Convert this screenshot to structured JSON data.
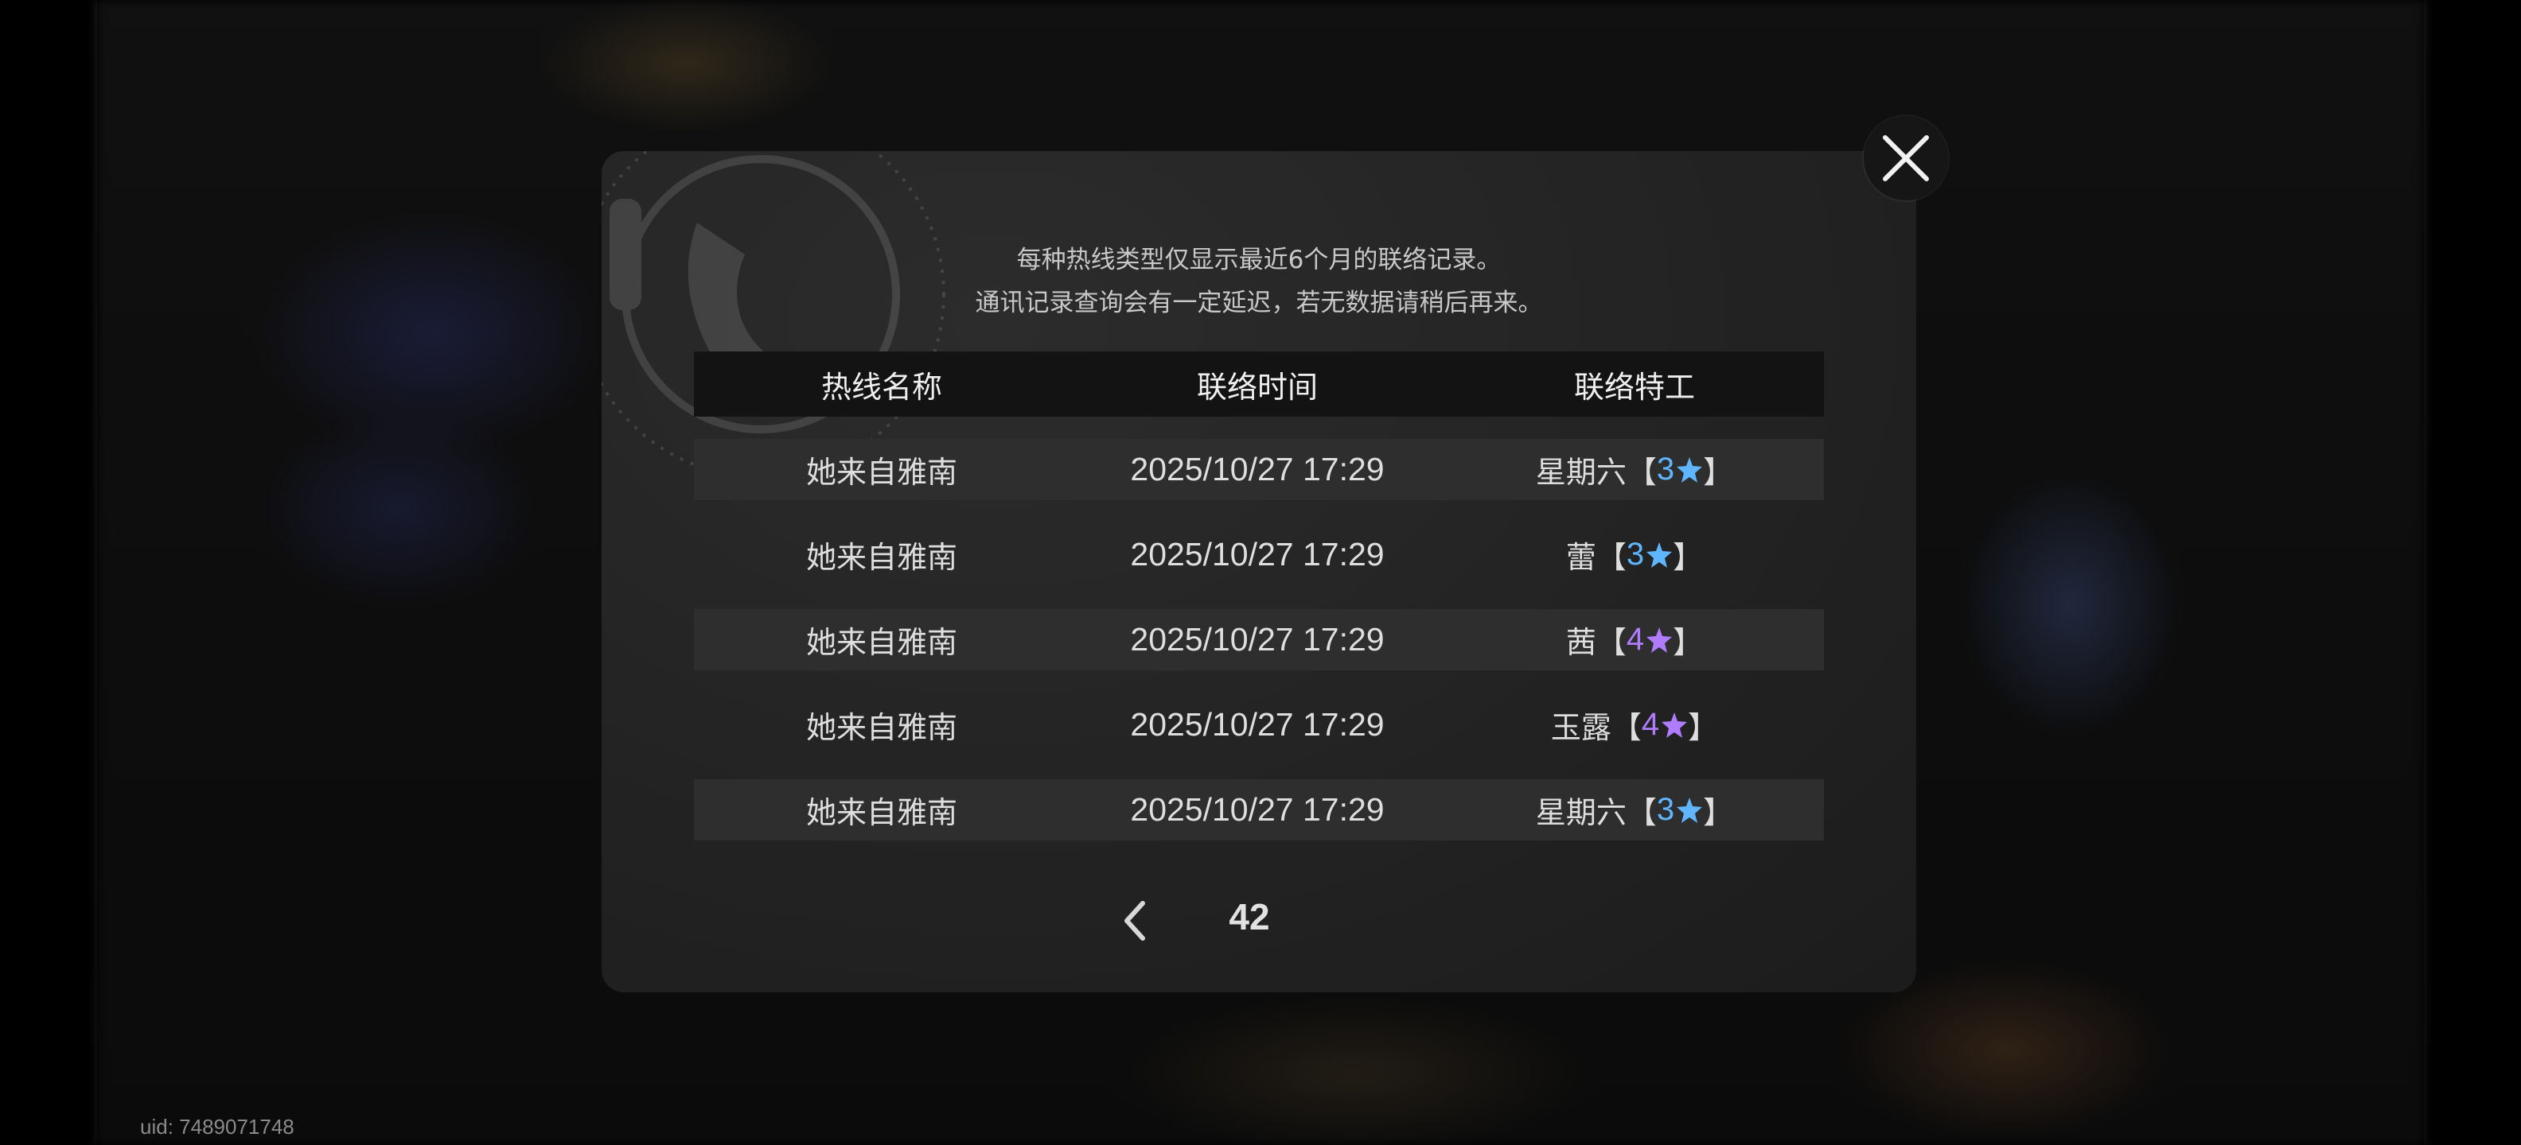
{
  "uid_label": "uid: 7489071748",
  "notice": {
    "line1": "每种热线类型仅显示最近6个月的联络记录。",
    "line2": "通讯记录查询会有一定延迟，若无数据请稍后再来。"
  },
  "table": {
    "headers": [
      "热线名称",
      "联络时间",
      "联络特工"
    ],
    "rows": [
      {
        "hotline": "她来自雅南",
        "time": "2025/10/27 17:29",
        "agent": "星期六",
        "rank": "3",
        "rank_color": "#5fb6ff"
      },
      {
        "hotline": "她来自雅南",
        "time": "2025/10/27 17:29",
        "agent": "蕾",
        "rank": "3",
        "rank_color": "#5fb6ff"
      },
      {
        "hotline": "她来自雅南",
        "time": "2025/10/27 17:29",
        "agent": "茜",
        "rank": "4",
        "rank_color": "#b07cff"
      },
      {
        "hotline": "她来自雅南",
        "time": "2025/10/27 17:29",
        "agent": "玉露",
        "rank": "4",
        "rank_color": "#b07cff"
      },
      {
        "hotline": "她来自雅南",
        "time": "2025/10/27 17:29",
        "agent": "星期六",
        "rank": "3",
        "rank_color": "#5fb6ff"
      }
    ]
  },
  "pager": {
    "page": "42"
  },
  "brackets": {
    "open": "【",
    "close": "】"
  },
  "icons": {
    "close": "close-icon",
    "prev": "chevron-left-icon",
    "rank_star": "star-icon",
    "watermark": "telephone-icon"
  }
}
